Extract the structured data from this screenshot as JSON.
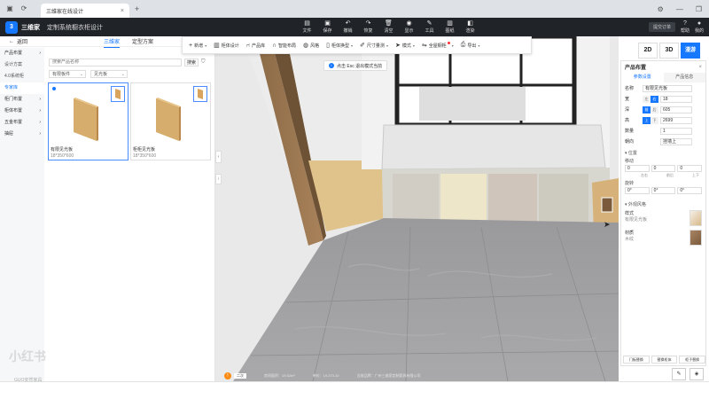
{
  "browser": {
    "tab_title": "三维家在线设计",
    "refresh_icon": "refresh-icon",
    "nav_icon": "browser-logo-icon"
  },
  "header": {
    "logo_text": "3",
    "app_name": "三维家",
    "app_subtitle": "定制系统橱衣柜设计",
    "menu": [
      "文件",
      "保存",
      "撤销",
      "恢复",
      "清空",
      "显示",
      "工具",
      "图纸",
      "渲染"
    ],
    "plan_button": "提交订单",
    "right_items": [
      "帮助",
      "我的"
    ]
  },
  "left_panel": {
    "back_label": "返回",
    "tabs": [
      "三维家",
      "定型方案"
    ],
    "active_tab": 0,
    "categories": [
      {
        "label": "产品布置",
        "arrow": "›",
        "active": false
      },
      {
        "label": "设计方案",
        "arrow": "",
        "active": false
      },
      {
        "label": "4.0系统柜",
        "arrow": "",
        "active": false
      },
      {
        "label": "专家库",
        "arrow": "",
        "active": true
      },
      {
        "label": "柜门布置",
        "arrow": "›",
        "active": false
      },
      {
        "label": "柜体布置",
        "arrow": "›",
        "active": false
      },
      {
        "label": "五金布置",
        "arrow": "›",
        "active": false
      },
      {
        "label": "抽屉",
        "arrow": "›",
        "active": false
      }
    ],
    "search_placeholder": "搜索产品名称",
    "search_button": "搜索",
    "filters": [
      "有限板件",
      "见光板"
    ],
    "products": [
      {
        "name": "有限见光板",
        "size": "18*350*600",
        "selected": true
      },
      {
        "name": "柜柜见光板",
        "size": "18*350*600",
        "selected": false
      }
    ]
  },
  "toolbar": {
    "items": [
      {
        "icon": "plus-icon",
        "label": "新增",
        "has_menu": true
      },
      {
        "icon": "cabinet-icon",
        "label": "柜体设计",
        "has_menu": false
      },
      {
        "icon": "chair-icon",
        "label": "产品库",
        "has_menu": false
      },
      {
        "icon": "magnet-icon",
        "label": "智能布局",
        "has_menu": false
      },
      {
        "icon": "palette-icon",
        "label": "风格",
        "has_menu": false
      },
      {
        "icon": "door-icon",
        "label": "柜体换型",
        "has_menu": true
      },
      {
        "icon": "ruler-icon",
        "label": "尺寸量测",
        "has_menu": true
      },
      {
        "icon": "cursor-icon",
        "label": "模式",
        "has_menu": true
      },
      {
        "icon": "shuffle-icon",
        "label": "全屋橱柜",
        "has_menu": true,
        "badge": true
      },
      {
        "icon": "export-icon",
        "label": "导出",
        "has_menu": true
      }
    ]
  },
  "viewport": {
    "hint_text": "点击 Esc 退出模式当前",
    "status": [
      "房间面积：19.52m²",
      "单价：19,273.10",
      "当前品牌：广州三维家定制家具有限公司"
    ],
    "warn_badge": "!",
    "warn_label": "二次"
  },
  "view_buttons": {
    "b2d": "2D",
    "b3d": "3D",
    "render": "漫游",
    "active": "render"
  },
  "right_panel": {
    "title": "产品布置",
    "tabs": [
      "参数设置",
      "产品信息"
    ],
    "name_label": "名称",
    "name_value": "有限见光板",
    "dims": [
      {
        "label": "宽",
        "segs": [
          "左",
          "右"
        ],
        "active": 1,
        "value": "18"
      },
      {
        "label": "深",
        "segs": [
          "前",
          "后"
        ],
        "active": 0,
        "value": "605"
      },
      {
        "label": "高",
        "segs": [
          "上",
          "下"
        ],
        "active": 0,
        "value": "2699"
      }
    ],
    "count_label": "数量",
    "count_value": "1",
    "orient_label": "朝向",
    "orient_value": "挂墙上",
    "position_title": "▾ 位置",
    "offset_label": "移动",
    "offset_values": [
      "0",
      "0",
      "0"
    ],
    "offset_sub": [
      "左右",
      "前后",
      "上下"
    ],
    "rotate_label": "旋转",
    "rotate_values": [
      "0°",
      "0°",
      "0°"
    ],
    "style_title": "▾ 外观风格",
    "style_label": "样式",
    "style_value": "有限见光板",
    "material_label": "材质",
    "material_value": "木纹",
    "bottom_buttons": [
      "门板替换",
      "替换柜体",
      "柜子替换"
    ]
  },
  "watermark": "小红书",
  "watermark_sub": "GUO安然家具"
}
